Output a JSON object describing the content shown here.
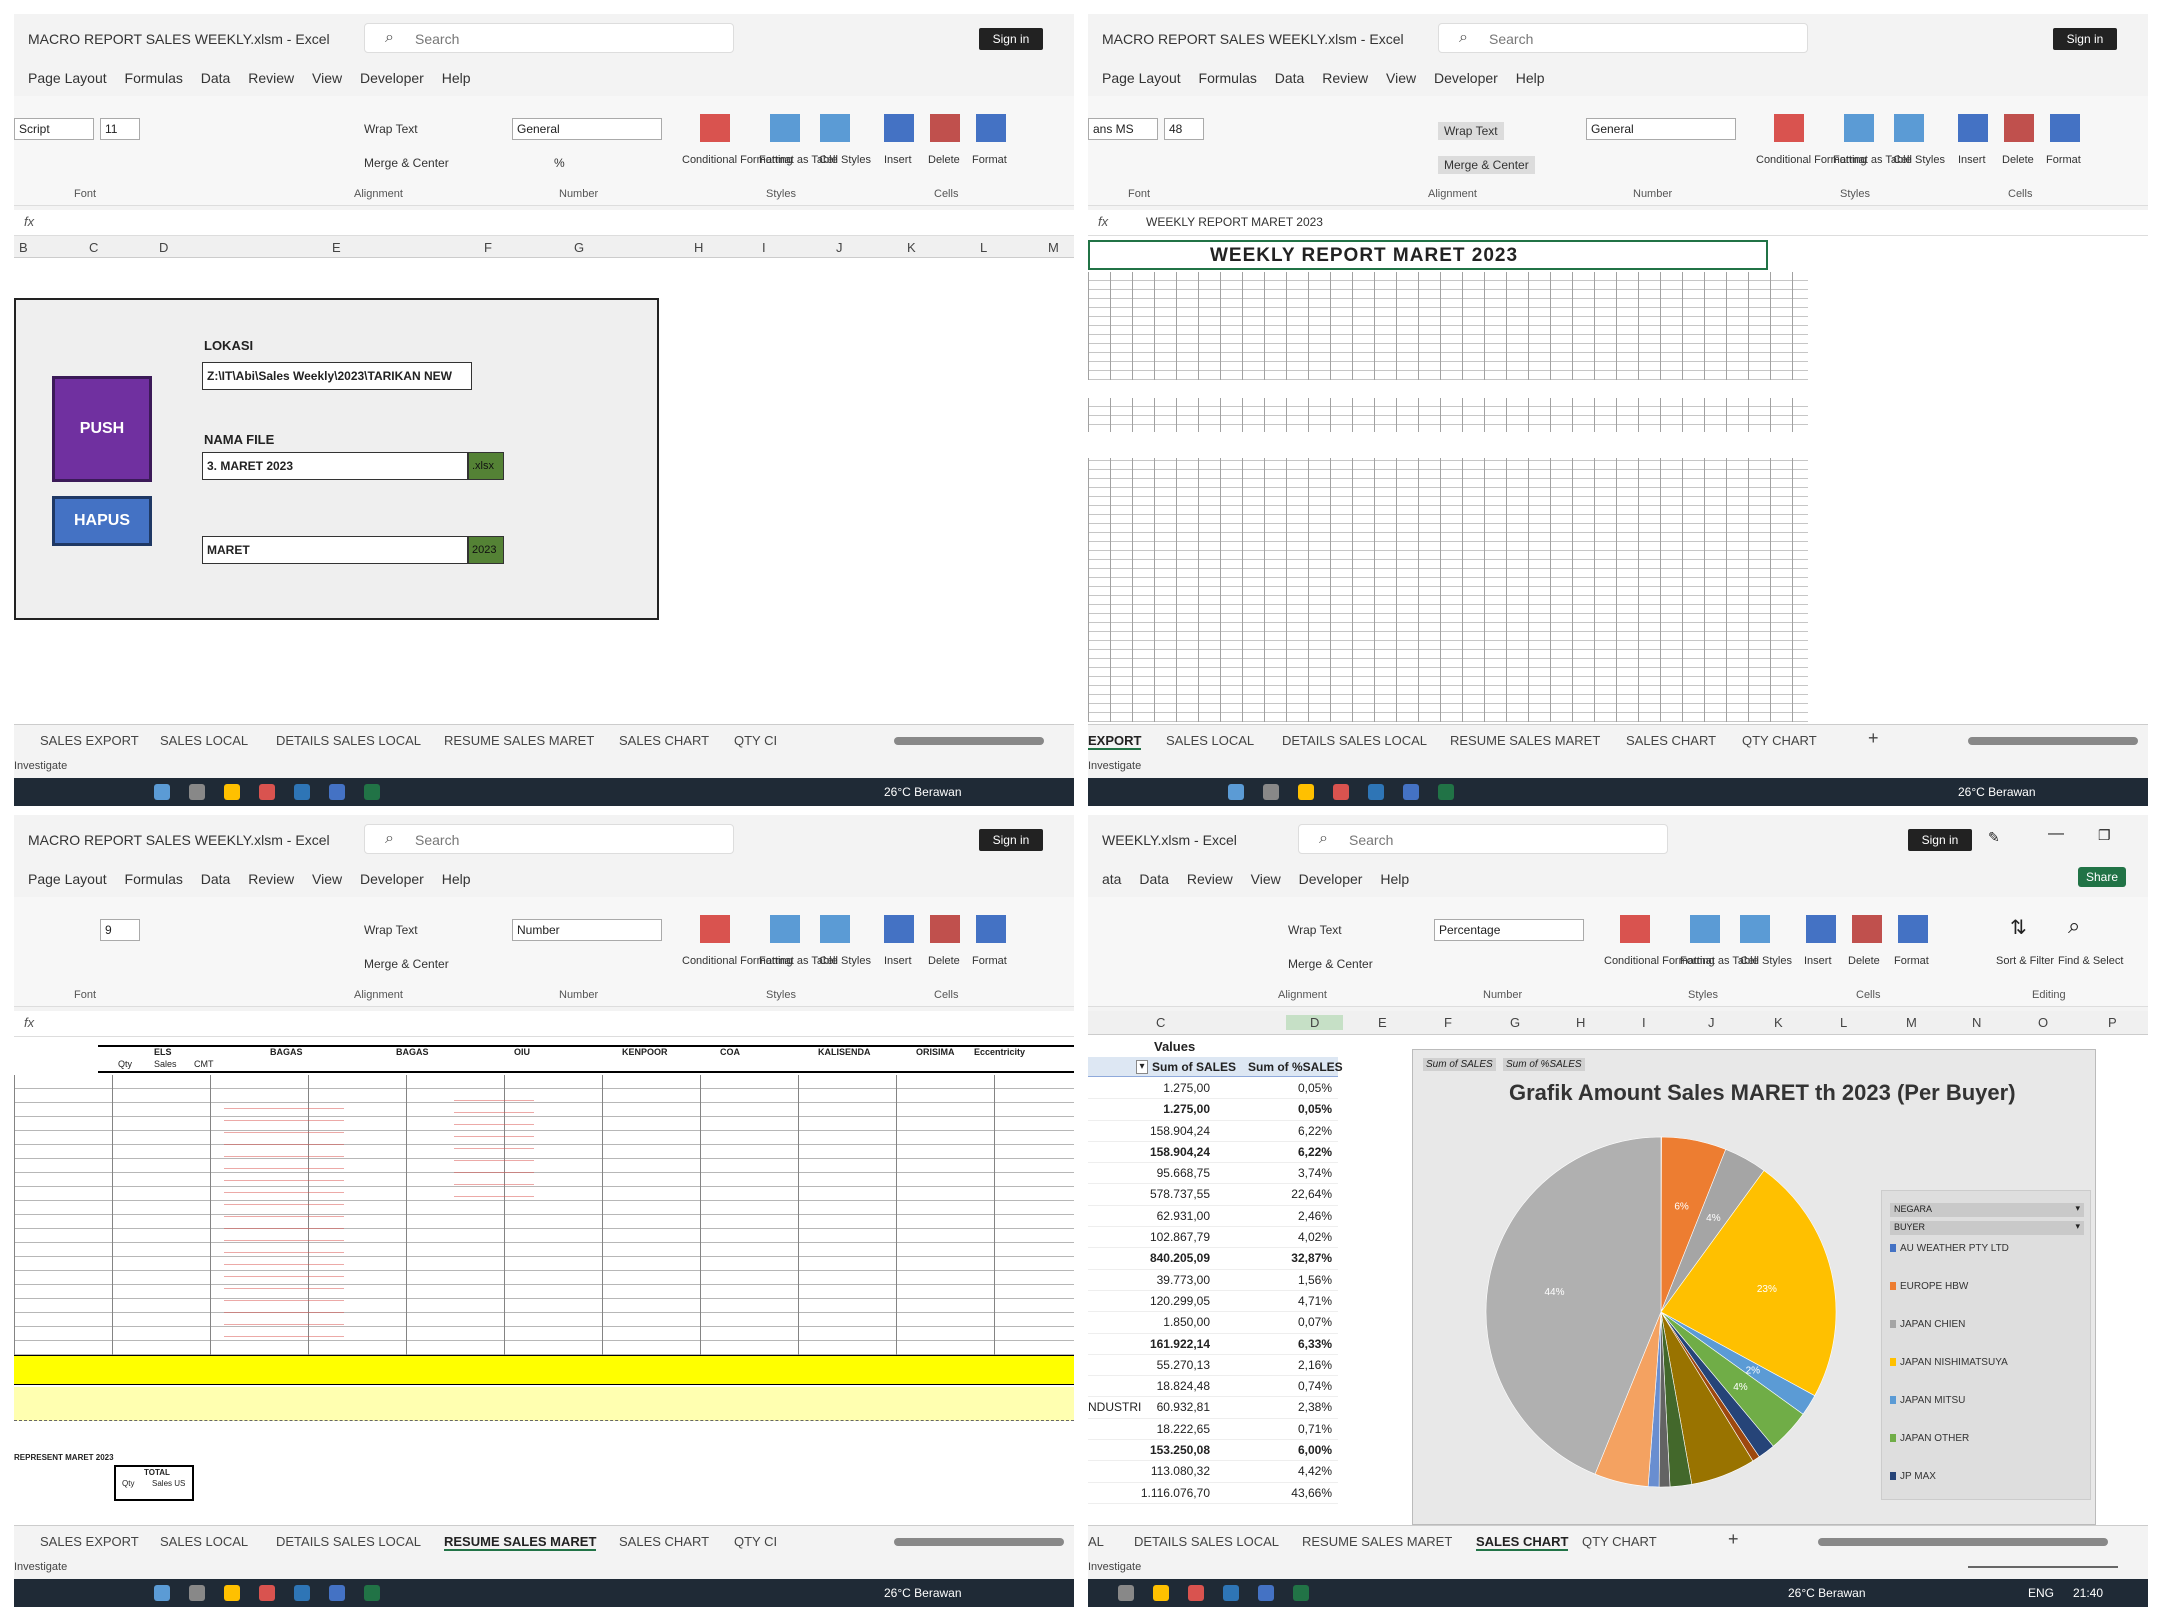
{
  "common": {
    "window_title": "MACRO REPORT SALES WEEKLY.xlsm - Excel",
    "window_title_short": "WEEKLY.xlsm - Excel",
    "search_placeholder": "Search",
    "sign_in": "Sign in",
    "share": "Share",
    "menu": [
      "Page Layout",
      "Formulas",
      "Data",
      "Review",
      "View",
      "Developer",
      "Help"
    ],
    "menu_short": [
      "ata",
      "Data",
      "Review",
      "View",
      "Developer",
      "Help"
    ],
    "ribbon": {
      "wrap_text": "Wrap Text",
      "merge_center": "Merge & Center",
      "conditional_formatting": "Conditional Formatting",
      "format_as_table": "Format as Table",
      "cell_styles": "Cell Styles",
      "insert": "Insert",
      "delete": "Delete",
      "format": "Format",
      "sort_filter": "Sort & Filter",
      "find_select": "Find & Select",
      "group_font": "Font",
      "group_alignment": "Alignment",
      "group_number": "Number",
      "group_styles": "Styles",
      "group_cells": "Cells",
      "group_editing": "Editing",
      "percent": "%",
      "comma": "9"
    },
    "fx": "fx",
    "status_left": "Investigate",
    "weather": "26°C Berawan",
    "lang": "ENG",
    "time": "21:40",
    "colors": {
      "excel_green": "#217346",
      "push": "#7030a0",
      "hapus": "#4472c4",
      "yellow": "#ffff00",
      "taskbar": "#1f2a36"
    }
  },
  "q1": {
    "font_name": "Script",
    "font_size": "11",
    "number_format": "General",
    "columns": [
      "B",
      "C",
      "D",
      "E",
      "F",
      "G",
      "H",
      "I",
      "J",
      "K",
      "L",
      "M"
    ],
    "panel": {
      "lokasi_label": "LOKASI",
      "lokasi_value": "Z:\\IT\\Abi\\Sales Weekly\\2023\\TARIKAN NEW",
      "push_button": "PUSH",
      "hapus_button": "HAPUS",
      "nama_file_label": "NAMA FILE",
      "nama_file_value": "3. MARET 2023",
      "ext": ".xlsx",
      "month_value": "MARET",
      "year_value": "2023"
    },
    "tabs": [
      "SALES EXPORT",
      "SALES LOCAL",
      "DETAILS SALES LOCAL",
      "RESUME SALES MARET",
      "SALES CHART",
      "QTY CI"
    ]
  },
  "q2": {
    "font_name": "ans MS",
    "font_size": "48",
    "number_format": "General",
    "formula": "WEEKLY REPORT MARET 2023",
    "report_title": "WEEKLY REPORT MARET 2023",
    "tabs": [
      "EXPORT",
      "SALES LOCAL",
      "DETAILS SALES LOCAL",
      "RESUME SALES MARET",
      "SALES CHART",
      "QTY CHART"
    ]
  },
  "q3": {
    "font_size": "9",
    "number_format": "Number",
    "section_headers": [
      "ELS",
      "BAGAS",
      "BAGAS",
      "OIU",
      "KENPOOR",
      "COA",
      "KALISENDA",
      "ORISIMA",
      "Eccentricity"
    ],
    "subheaders": [
      "Qty",
      "Sales",
      "CMT"
    ],
    "bottom_title": "REPRESENT MARET 2023",
    "bottom_table_header": "TOTAL",
    "bottom_table_sub": [
      "Qty",
      "Sales US"
    ],
    "tabs": [
      "SALES EXPORT",
      "SALES LOCAL",
      "DETAILS SALES LOCAL",
      "RESUME SALES MARET",
      "SALES CHART",
      "QTY CI"
    ]
  },
  "q4": {
    "number_format": "Percentage",
    "columns": [
      "C",
      "D",
      "E",
      "F",
      "G",
      "H",
      "I",
      "J",
      "K",
      "L",
      "M",
      "N",
      "O",
      "P"
    ],
    "pivot": {
      "values_label": "Values",
      "col1": "Sum of SALES",
      "col2": "Sum of %SALES",
      "rows": [
        {
          "label": "",
          "sales": "1.275,00",
          "pct": "0,05%",
          "bold": false
        },
        {
          "label": "",
          "sales": "1.275,00",
          "pct": "0,05%",
          "bold": true
        },
        {
          "label": "",
          "sales": "158.904,24",
          "pct": "6,22%",
          "bold": false
        },
        {
          "label": "",
          "sales": "158.904,24",
          "pct": "6,22%",
          "bold": true
        },
        {
          "label": "",
          "sales": "95.668,75",
          "pct": "3,74%",
          "bold": false
        },
        {
          "label": "",
          "sales": "578.737,55",
          "pct": "22,64%",
          "bold": false
        },
        {
          "label": "",
          "sales": "62.931,00",
          "pct": "2,46%",
          "bold": false
        },
        {
          "label": "",
          "sales": "102.867,79",
          "pct": "4,02%",
          "bold": false
        },
        {
          "label": "",
          "sales": "840.205,09",
          "pct": "32,87%",
          "bold": true
        },
        {
          "label": "",
          "sales": "39.773,00",
          "pct": "1,56%",
          "bold": false
        },
        {
          "label": "",
          "sales": "120.299,05",
          "pct": "4,71%",
          "bold": false
        },
        {
          "label": "",
          "sales": "1.850,00",
          "pct": "0,07%",
          "bold": false
        },
        {
          "label": "",
          "sales": "161.922,14",
          "pct": "6,33%",
          "bold": true
        },
        {
          "label": "",
          "sales": "55.270,13",
          "pct": "2,16%",
          "bold": false
        },
        {
          "label": "",
          "sales": "18.824,48",
          "pct": "0,74%",
          "bold": false
        },
        {
          "label": "NDUSTRI",
          "sales": "60.932,81",
          "pct": "2,38%",
          "bold": false
        },
        {
          "label": "",
          "sales": "18.222,65",
          "pct": "0,71%",
          "bold": false
        },
        {
          "label": "",
          "sales": "153.250,08",
          "pct": "6,00%",
          "bold": true
        },
        {
          "label": "",
          "sales": "113.080,32",
          "pct": "4,42%",
          "bold": false
        },
        {
          "label": "",
          "sales": "1.116.076,70",
          "pct": "43,66%",
          "bold": false
        }
      ]
    },
    "field_buttons": [
      "Sum of SALES",
      "Sum of %SALES"
    ],
    "legend_filters": [
      "NEGARA",
      "BUYER"
    ],
    "legend_items": [
      {
        "label": "AU WEATHER PTY LTD",
        "color": "#4472c4"
      },
      {
        "label": "EUROPE HBW",
        "color": "#ed7d31"
      },
      {
        "label": "JAPAN CHIEN",
        "color": "#a5a5a5"
      },
      {
        "label": "JAPAN NISHIMATSUYA",
        "color": "#ffc000"
      },
      {
        "label": "JAPAN MITSU",
        "color": "#5b9bd5"
      },
      {
        "label": "JAPAN OTHER",
        "color": "#70ad47"
      },
      {
        "label": "JP MAX",
        "color": "#264478"
      }
    ],
    "tabs": [
      "AL",
      "DETAILS SALES LOCAL",
      "RESUME SALES MARET",
      "SALES CHART",
      "QTY CHART"
    ]
  },
  "chart_data": {
    "type": "pie",
    "title": "Grafik Amount Sales MARET th 2023 (Per Buyer)",
    "slices": [
      {
        "label": "AU WEATHER PTY LTD",
        "value": 0.05,
        "color": "#4472c4"
      },
      {
        "label": "EUROPE HBW",
        "value": 6,
        "color": "#ed7d31",
        "data_label": "6%"
      },
      {
        "label": "JAPAN CHIEN",
        "value": 4,
        "color": "#a5a5a5",
        "data_label": "4%"
      },
      {
        "label": "JAPAN NISHIMATSUYA",
        "value": 23,
        "color": "#ffc000",
        "data_label": "23%"
      },
      {
        "label": "JAPAN MITSU",
        "value": 2,
        "color": "#5b9bd5",
        "data_label": "2%"
      },
      {
        "label": "JAPAN OTHER",
        "value": 4,
        "color": "#70ad47",
        "data_label": "4%"
      },
      {
        "label": "JP MAX",
        "value": 1.6,
        "color": "#264478"
      },
      {
        "label": "",
        "value": 0.7,
        "color": "#9e480e"
      },
      {
        "label": "",
        "value": 6,
        "color": "#997300"
      },
      {
        "label": "",
        "value": 2,
        "color": "#43682b"
      },
      {
        "label": "",
        "value": 1,
        "color": "#636363"
      },
      {
        "label": "",
        "value": 1,
        "color": "#698ed0"
      },
      {
        "label": "",
        "value": 5,
        "color": "#f4a261"
      },
      {
        "label": "",
        "value": 44,
        "color": "#b0b0b0",
        "data_label": "44%"
      }
    ]
  }
}
